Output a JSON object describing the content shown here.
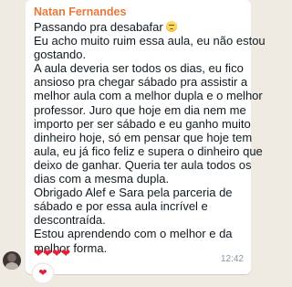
{
  "message": {
    "sender": "Natan Fernandes",
    "sender_color": "#e8783a",
    "emoji_icon": "sad-face-emoji",
    "lines": [
      "Passando pra desabafar",
      "Eu acho muito ruim essa aula, eu não estou",
      "gostando.",
      "A aula deveria ser todos os dias, eu fico",
      "ansioso pra chegar sábado pra assistir a",
      "melhor aula com a melhor dupla e o melhor",
      "professor. Juro que hoje em dia nem me",
      "importo per ser sábado e eu ganho muito",
      "dinheiro hoje, só em pensar que hoje tem",
      "aula, eu já fico feliz e supera o dinheiro que",
      "deixo de ganhar. Queria ter aula todos os",
      "dias com a mesma dupla.",
      "Obrigado Alef e Sara pela parceria de",
      "sábado e por essa aula incrível e",
      "descontraída.",
      "Estou aprendendo com o melhor e da",
      "melhor forma."
    ],
    "hearts": "❤❤❤❤",
    "time": "12:42",
    "reaction": "❤"
  },
  "colors": {
    "chat_background": "#efeae2",
    "bubble_background": "#ffffff",
    "text": "#111b21",
    "timestamp": "#8696a0",
    "heart": "#e0203a"
  }
}
